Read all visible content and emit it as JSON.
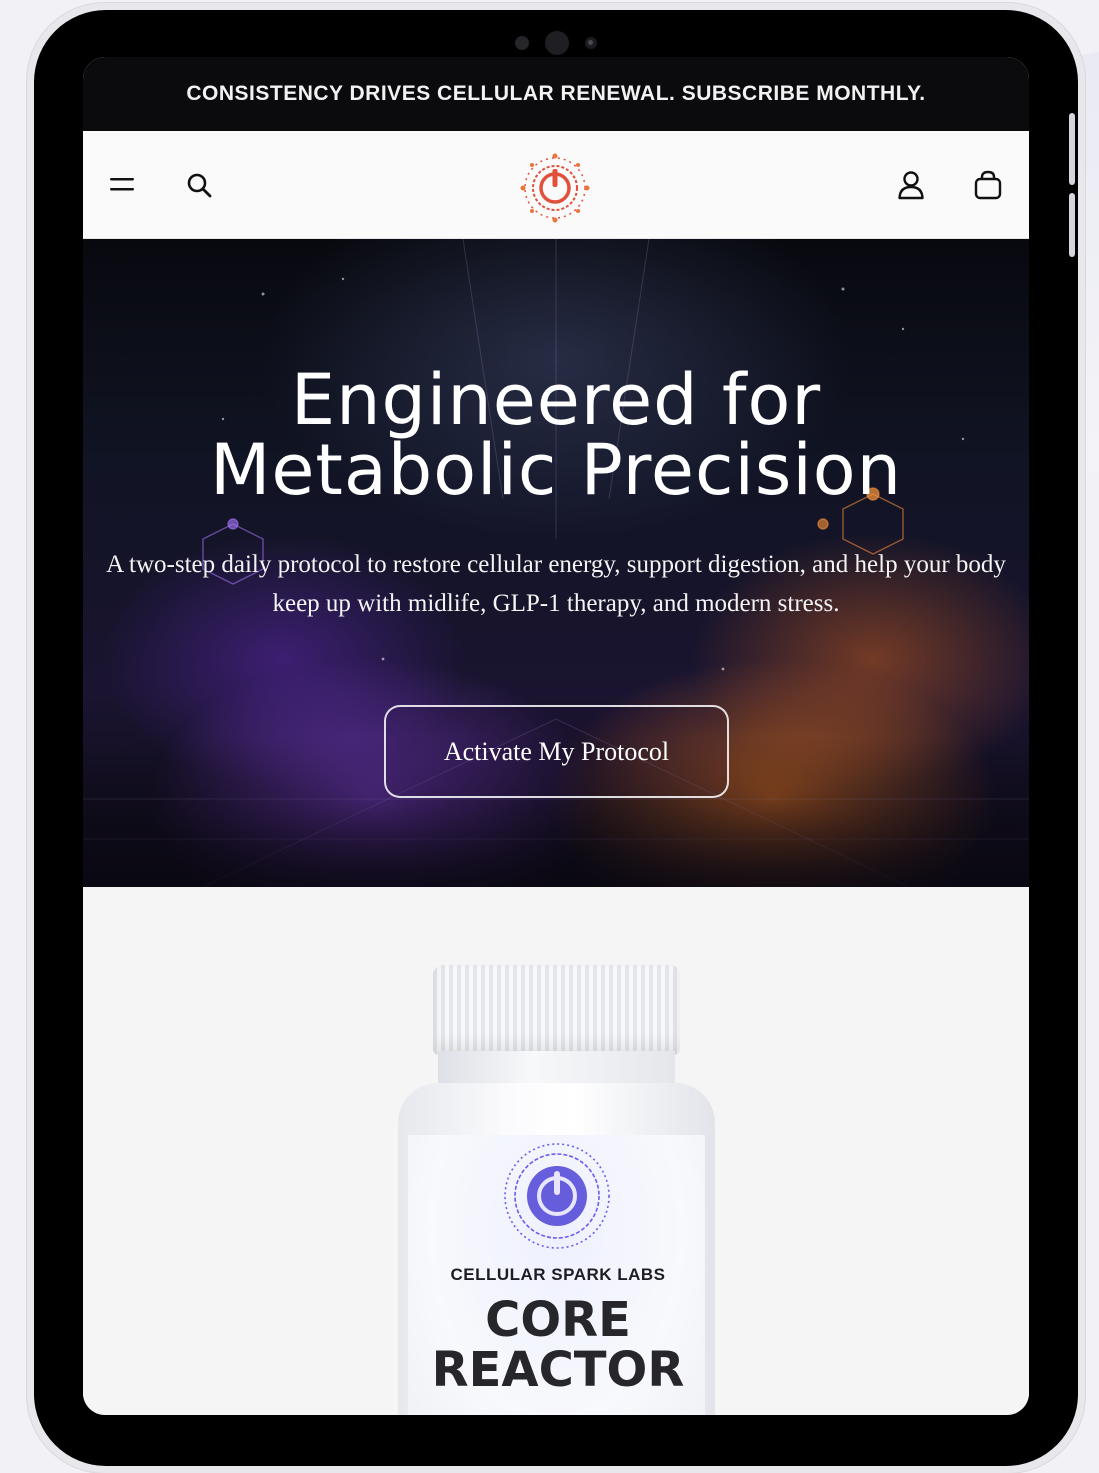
{
  "announcement": {
    "text": "CONSISTENCY DRIVES CELLULAR RENEWAL. SUBSCRIBE MONTHLY."
  },
  "header": {
    "icons": [
      "menu-icon",
      "search-icon",
      "brand-logo",
      "account-icon",
      "cart-icon"
    ],
    "accent_color": "#e0503a"
  },
  "hero": {
    "title_line1": "Engineered for",
    "title_line2": "Metabolic Precision",
    "subtitle": "A two-step daily protocol to restore cellular energy, support digestion, and help your body keep up with midlife, GLP-1 therapy, and modern stress.",
    "cta_label": "Activate My Protocol",
    "colors": {
      "purple": "#7a3ccf",
      "orange": "#e0731f"
    }
  },
  "product": {
    "brand": "CELLULAR SPARK LABS",
    "name_line1": "CORE",
    "name_line2": "REACTOR",
    "accent_color": "#5b4fe0"
  }
}
